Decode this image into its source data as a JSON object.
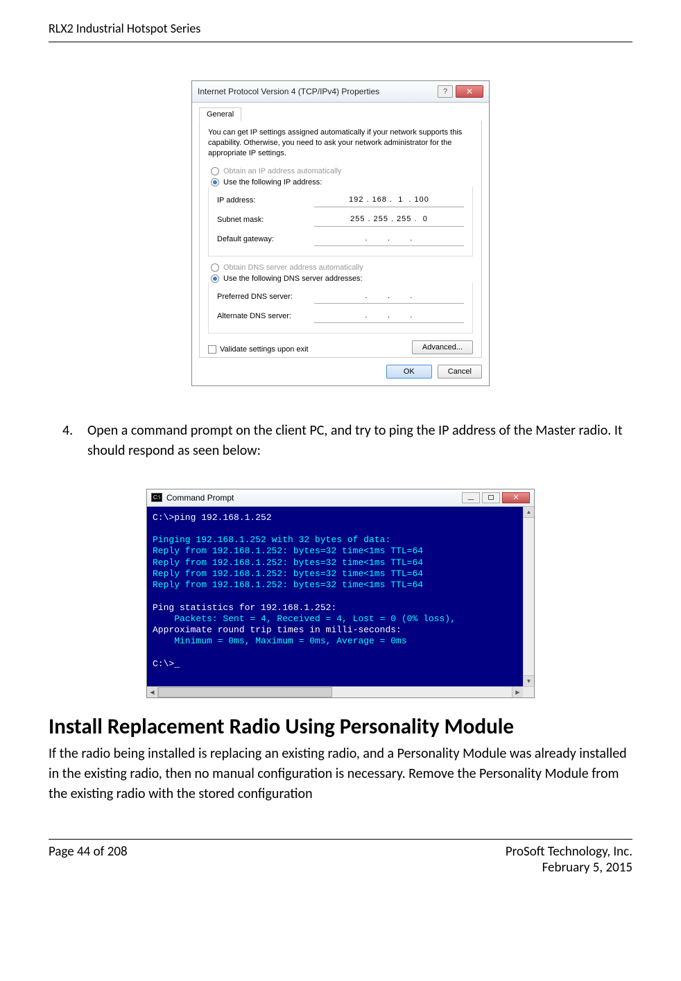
{
  "header": {
    "title": "RLX2 Industrial Hotspot Series"
  },
  "dialog": {
    "title": "Internet Protocol Version 4 (TCP/IPv4) Properties",
    "tab": "General",
    "description": "You can get IP settings assigned automatically if your network supports this capability. Otherwise, you need to ask your network administrator for the appropriate IP settings.",
    "radio_obtain_ip": "Obtain an IP address automatically",
    "radio_use_ip": "Use the following IP address:",
    "label_ip": "IP address:",
    "value_ip": "192 . 168 .  1  . 100",
    "label_subnet": "Subnet mask:",
    "value_subnet": "255 . 255 . 255 .  0",
    "label_gateway": "Default gateway:",
    "value_gateway": ".       .       .",
    "radio_obtain_dns": "Obtain DNS server address automatically",
    "radio_use_dns": "Use the following DNS server addresses:",
    "label_pref_dns": "Preferred DNS server:",
    "value_pref_dns": ".       .       .",
    "label_alt_dns": "Alternate DNS server:",
    "value_alt_dns": ".       .       .",
    "checkbox_validate": "Validate settings upon exit",
    "btn_advanced": "Advanced...",
    "btn_ok": "OK",
    "btn_cancel": "Cancel"
  },
  "step": {
    "number": "4.",
    "text": "Open a command prompt on the client PC, and try to ping the IP address of the Master radio. It should respond as seen below:"
  },
  "cmd": {
    "title": "Command Prompt",
    "line1": "C:\\>ping 192.168.1.252",
    "blank": "",
    "line2": "Pinging 192.168.1.252 with 32 bytes of data:",
    "reply": "Reply from 192.168.1.252: bytes=32 time<1ms TTL=64",
    "stats1": "Ping statistics for 192.168.1.252:",
    "stats2": "    Packets: Sent = 4, Received = 4, Lost = 0 (0% loss),",
    "stats3": "Approximate round trip times in milli-seconds:",
    "stats4": "    Minimum = 0ms, Maximum = 0ms, Average = 0ms",
    "prompt": "C:\\>_"
  },
  "section": {
    "heading": "Install Replacement Radio Using Personality Module",
    "body": "If the radio being installed is replacing an existing radio, and a Personality Module was already installed in the existing radio, then no manual configuration is necessary. Remove the Personality Module from the existing radio with the stored configuration"
  },
  "footer": {
    "page": "Page 44 of 208",
    "company": "ProSoft Technology, Inc.",
    "date": "February 5, 2015"
  }
}
